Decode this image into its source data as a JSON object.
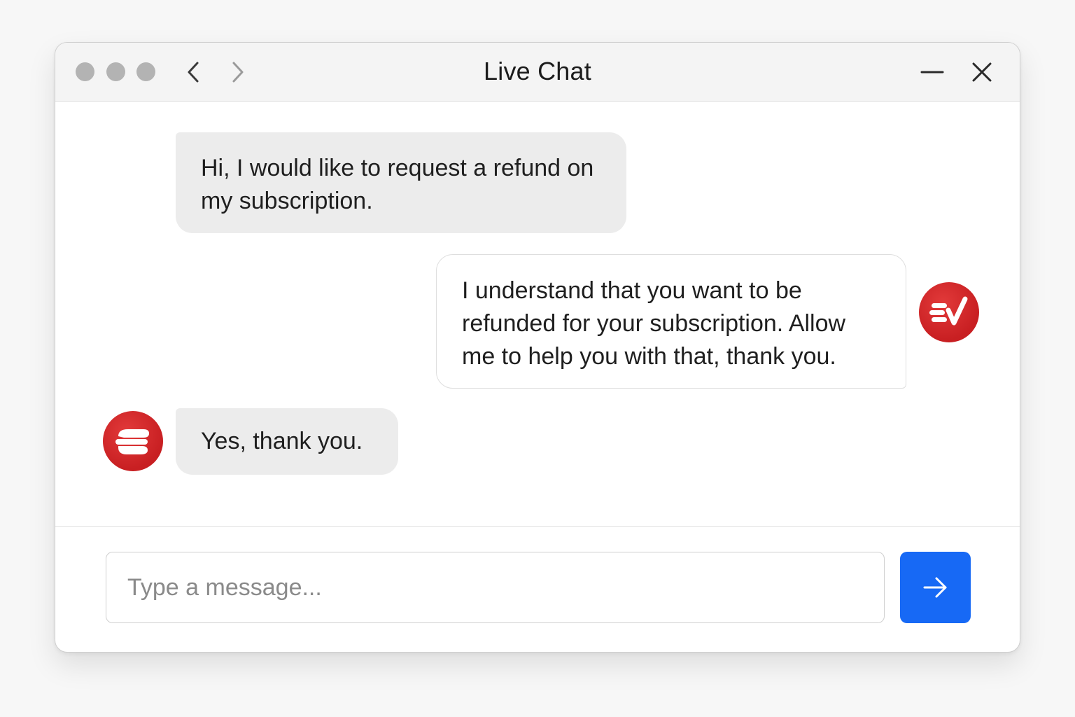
{
  "window": {
    "title": "Live Chat"
  },
  "messages": [
    {
      "sender": "user",
      "text": "Hi, I would like to request a refund on my subscription."
    },
    {
      "sender": "agent",
      "text": "I understand that you want to be refunded for your subscription. Allow me to help you with that, thank you."
    },
    {
      "sender": "user",
      "text": "Yes, thank you."
    }
  ],
  "composer": {
    "placeholder": "Type a message...",
    "value": ""
  },
  "icons": {
    "back": "chevron-left-icon",
    "forward": "chevron-right-icon",
    "minimize": "minimize-icon",
    "close": "close-icon",
    "send": "arrow-right-icon",
    "avatar": "brand-logo-icon"
  },
  "colors": {
    "accent": "#1769f5",
    "brand": "#d0262a"
  }
}
